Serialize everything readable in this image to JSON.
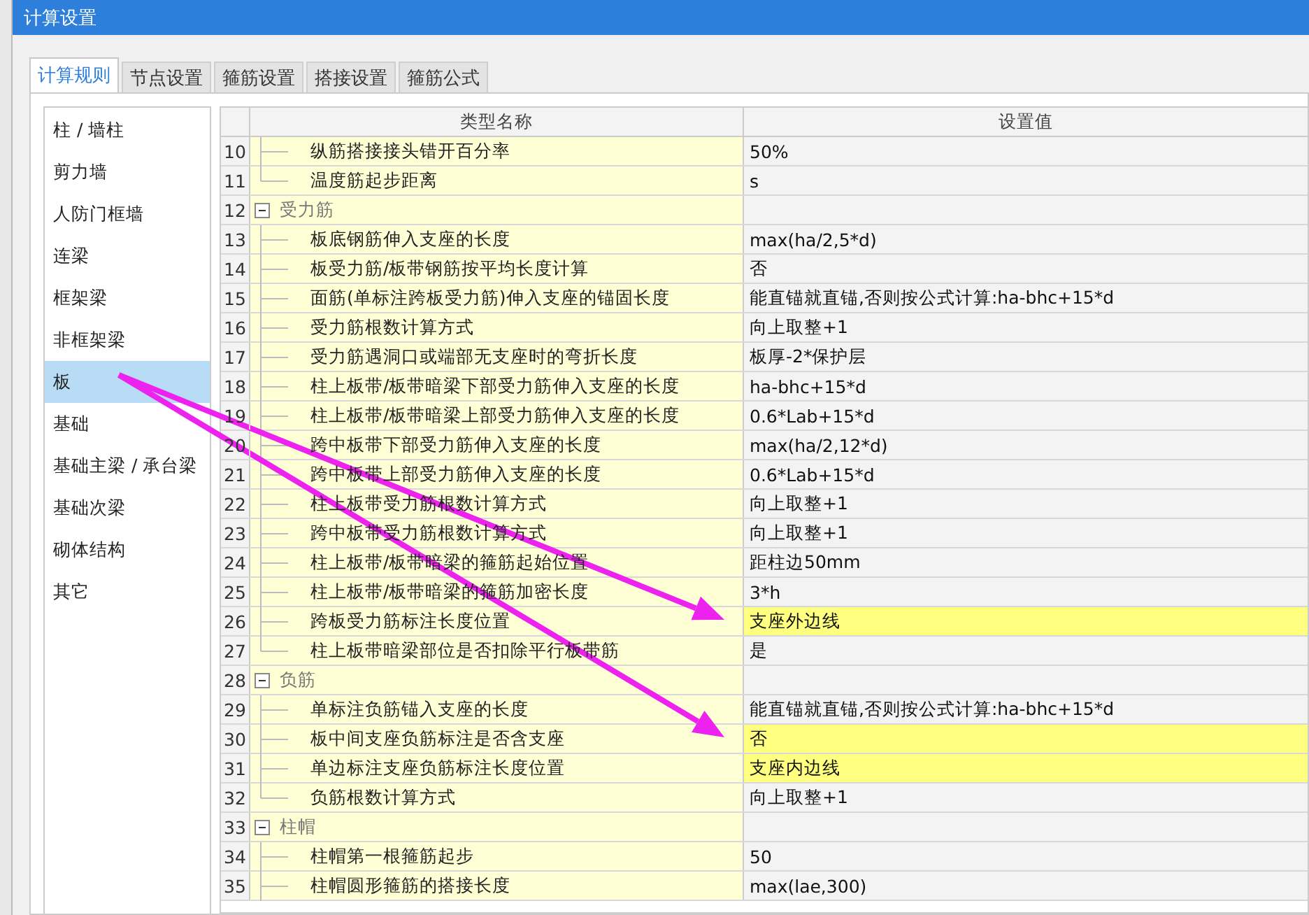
{
  "window": {
    "title": "计算设置"
  },
  "tabs": [
    {
      "label": "计算规则",
      "selected": true
    },
    {
      "label": "节点设置",
      "selected": false
    },
    {
      "label": "箍筋设置",
      "selected": false
    },
    {
      "label": "搭接设置",
      "selected": false
    },
    {
      "label": "箍筋公式",
      "selected": false
    }
  ],
  "sidebar": {
    "items": [
      {
        "label": "柱 / 墙柱",
        "selected": false
      },
      {
        "label": "剪力墙",
        "selected": false
      },
      {
        "label": "人防门框墙",
        "selected": false
      },
      {
        "label": "连梁",
        "selected": false
      },
      {
        "label": "框架梁",
        "selected": false
      },
      {
        "label": "非框架梁",
        "selected": false
      },
      {
        "label": "板",
        "selected": true
      },
      {
        "label": "基础",
        "selected": false
      },
      {
        "label": "基础主梁 / 承台梁",
        "selected": false
      },
      {
        "label": "基础次梁",
        "selected": false
      },
      {
        "label": "砌体结构",
        "selected": false
      },
      {
        "label": "其它",
        "selected": false
      }
    ]
  },
  "table": {
    "columns": [
      "类型名称",
      "设置值"
    ],
    "rows": [
      {
        "kind": "setting",
        "number": "10",
        "name": "纵筋搭接接头错开百分率",
        "value": "50%",
        "highlighted": false,
        "annotated": false
      },
      {
        "kind": "setting",
        "number": "11",
        "name": "温度筋起步距离",
        "value": "s",
        "highlighted": false,
        "annotated": false
      },
      {
        "kind": "group",
        "number": "12",
        "name": "受力筋",
        "expanded": true
      },
      {
        "kind": "setting",
        "number": "13",
        "name": "板底钢筋伸入支座的长度",
        "value": "max(ha/2,5*d)",
        "highlighted": false,
        "annotated": false
      },
      {
        "kind": "setting",
        "number": "14",
        "name": "板受力筋/板带钢筋按平均长度计算",
        "value": "否",
        "highlighted": false,
        "annotated": false
      },
      {
        "kind": "setting",
        "number": "15",
        "name": "面筋(单标注跨板受力筋)伸入支座的锚固长度",
        "value": "能直锚就直锚,否则按公式计算:ha-bhc+15*d",
        "highlighted": false,
        "annotated": false
      },
      {
        "kind": "setting",
        "number": "16",
        "name": "受力筋根数计算方式",
        "value": "向上取整+1",
        "highlighted": false,
        "annotated": false
      },
      {
        "kind": "setting",
        "number": "17",
        "name": "受力筋遇洞口或端部无支座时的弯折长度",
        "value": "板厚-2*保护层",
        "highlighted": false,
        "annotated": false
      },
      {
        "kind": "setting",
        "number": "18",
        "name": "柱上板带/板带暗梁下部受力筋伸入支座的长度",
        "value": "ha-bhc+15*d",
        "highlighted": false,
        "annotated": false
      },
      {
        "kind": "setting",
        "number": "19",
        "name": "柱上板带/板带暗梁上部受力筋伸入支座的长度",
        "value": "0.6*Lab+15*d",
        "highlighted": false,
        "annotated": false
      },
      {
        "kind": "setting",
        "number": "20",
        "name": "跨中板带下部受力筋伸入支座的长度",
        "value": "max(ha/2,12*d)",
        "highlighted": false,
        "annotated": false
      },
      {
        "kind": "setting",
        "number": "21",
        "name": "跨中板带上部受力筋伸入支座的长度",
        "value": "0.6*Lab+15*d",
        "highlighted": false,
        "annotated": false
      },
      {
        "kind": "setting",
        "number": "22",
        "name": "柱上板带受力筋根数计算方式",
        "value": "向上取整+1",
        "highlighted": false,
        "annotated": false
      },
      {
        "kind": "setting",
        "number": "23",
        "name": "跨中板带受力筋根数计算方式",
        "value": "向上取整+1",
        "highlighted": false,
        "annotated": false
      },
      {
        "kind": "setting",
        "number": "24",
        "name": "柱上板带/板带暗梁的箍筋起始位置",
        "value": "距柱边50mm",
        "highlighted": false,
        "annotated": false
      },
      {
        "kind": "setting",
        "number": "25",
        "name": "柱上板带/板带暗梁的箍筋加密长度",
        "value": "3*h",
        "highlighted": false,
        "annotated": false
      },
      {
        "kind": "setting",
        "number": "26",
        "name": "跨板受力筋标注长度位置",
        "value": "支座外边线",
        "highlighted": true,
        "annotated": true
      },
      {
        "kind": "setting",
        "number": "27",
        "name": "柱上板带暗梁部位是否扣除平行板带筋",
        "value": "是",
        "highlighted": false,
        "annotated": false
      },
      {
        "kind": "group",
        "number": "28",
        "name": "负筋",
        "expanded": true
      },
      {
        "kind": "setting",
        "number": "29",
        "name": "单标注负筋锚入支座的长度",
        "value": "能直锚就直锚,否则按公式计算:ha-bhc+15*d",
        "highlighted": false,
        "annotated": false
      },
      {
        "kind": "setting",
        "number": "30",
        "name": "板中间支座负筋标注是否含支座",
        "value": "否",
        "highlighted": true,
        "annotated": true
      },
      {
        "kind": "setting",
        "number": "31",
        "name": "单边标注支座负筋标注长度位置",
        "value": "支座内边线",
        "highlighted": true,
        "annotated": false
      },
      {
        "kind": "setting",
        "number": "32",
        "name": "负筋根数计算方式",
        "value": "向上取整+1",
        "highlighted": false,
        "annotated": false
      },
      {
        "kind": "group",
        "number": "33",
        "name": "柱帽",
        "expanded": true
      },
      {
        "kind": "setting",
        "number": "34",
        "name": "柱帽第一根箍筋起步",
        "value": "50",
        "highlighted": false,
        "annotated": false
      },
      {
        "kind": "setting",
        "number": "35",
        "name": "柱帽圆形箍筋的搭接长度",
        "value": "max(lae,300)",
        "highlighted": false,
        "annotated": false
      }
    ]
  }
}
